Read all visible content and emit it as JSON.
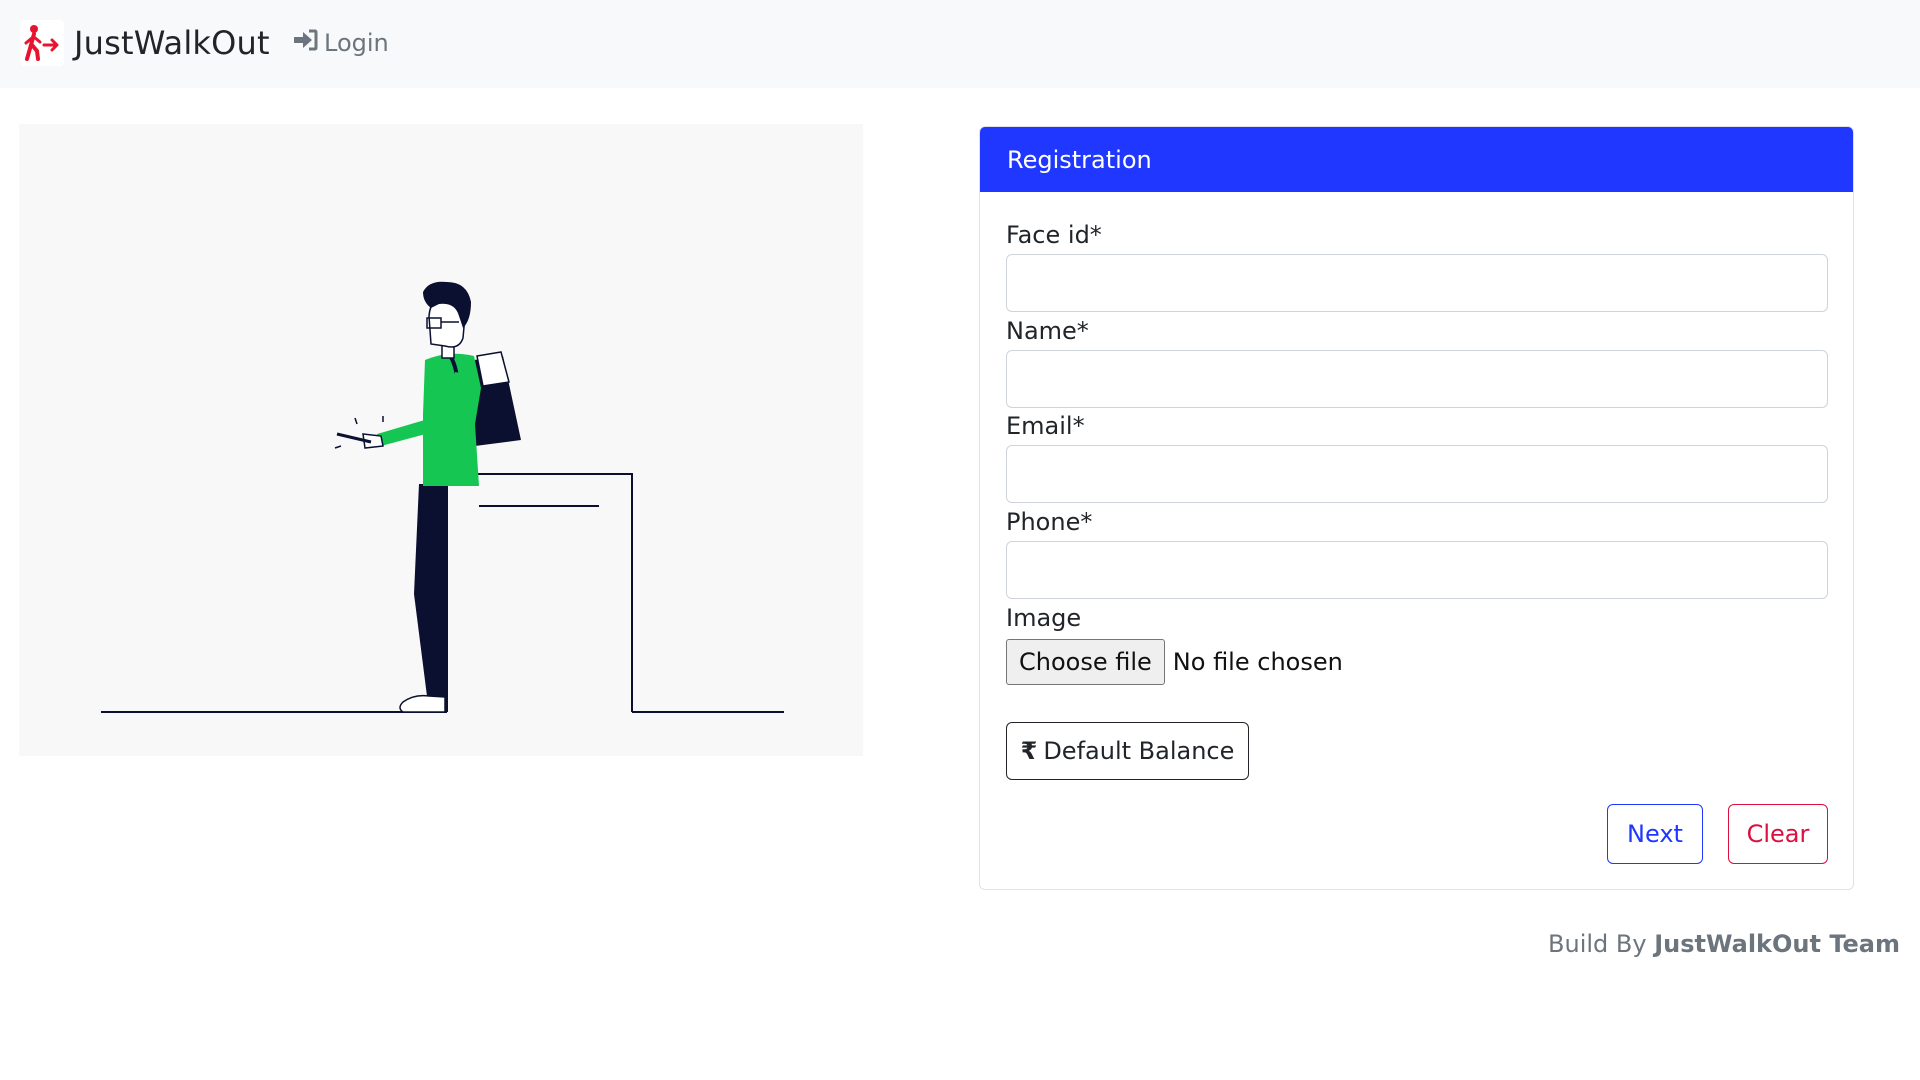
{
  "navbar": {
    "brand": "JustWalkOut",
    "login_label": "Login"
  },
  "registration": {
    "title": "Registration",
    "fields": [
      {
        "label": "Face id*",
        "value": "",
        "placeholder": ""
      },
      {
        "label": "Name*",
        "value": "",
        "placeholder": ""
      },
      {
        "label": "Email*",
        "value": "",
        "placeholder": ""
      },
      {
        "label": "Phone*",
        "value": "",
        "placeholder": ""
      }
    ],
    "image": {
      "label": "Image",
      "button": "Choose file",
      "status": "No file chosen"
    },
    "default_balance_label": "Default Balance",
    "next_label": "Next",
    "clear_label": "Clear"
  },
  "footer": {
    "prefix": "Build By",
    "team": "JustWalkOut Team"
  },
  "colors": {
    "primary": "#1f37ff",
    "danger": "#dc0f3f",
    "accent_green": "#16c653",
    "navy": "#0b1030",
    "brand_red": "#e8132e"
  },
  "icons": {
    "brand": "walking-person-exit-icon",
    "login": "sign-in-icon",
    "balance": "rupee-icon"
  }
}
